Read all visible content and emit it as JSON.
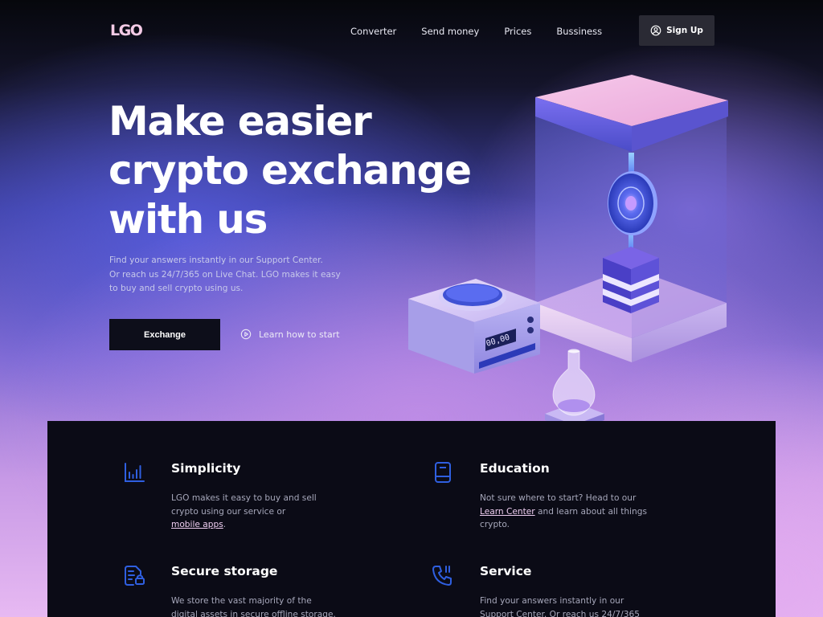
{
  "header": {
    "logo": "LGO",
    "nav": [
      "Converter",
      "Send money",
      "Prices",
      "Bussiness"
    ],
    "signup_label": "Sign Up"
  },
  "hero": {
    "title_lines": [
      "Make easier",
      "crypto exchange",
      "with us"
    ],
    "desc_lines": [
      "Find your answers instantly in our Support Center.",
      "Or reach us 24/7/365 on Live Chat. LGO makes it easy",
      "to buy and sell crypto using us."
    ],
    "exchange_label": "Exchange",
    "learn_label": "Learn how to start"
  },
  "illustration": {
    "scale_display": "00,00"
  },
  "features": {
    "simplicity": {
      "title": "Simplicity",
      "line1": "LGO makes it easy to buy and sell",
      "line2": "crypto using our service or",
      "link": "mobile apps",
      "after_link": "."
    },
    "education": {
      "title": "Education",
      "line1": "Not sure where to start? Head to our",
      "link": "Learn Center",
      "after_link": " and learn about all things",
      "line3": "crypto."
    },
    "storage": {
      "title": "Secure storage",
      "line1": "We store the vast majority of the",
      "line2": "digital assets in secure offline storage."
    },
    "service": {
      "title": "Service",
      "line1": "Find your answers instantly in our",
      "line2": "Support Center. Or reach us 24/7/365"
    }
  },
  "colors": {
    "accent_blue": "#2f5fe0",
    "panel_bg": "#0b0b16",
    "link_pink": "#eecdf0"
  },
  "icons": {
    "signup": "user-circle-icon",
    "learn": "play-circle-icon",
    "simplicity": "bar-chart-icon",
    "education": "book-icon",
    "storage": "secure-document-icon",
    "service": "phone-call-icon"
  }
}
